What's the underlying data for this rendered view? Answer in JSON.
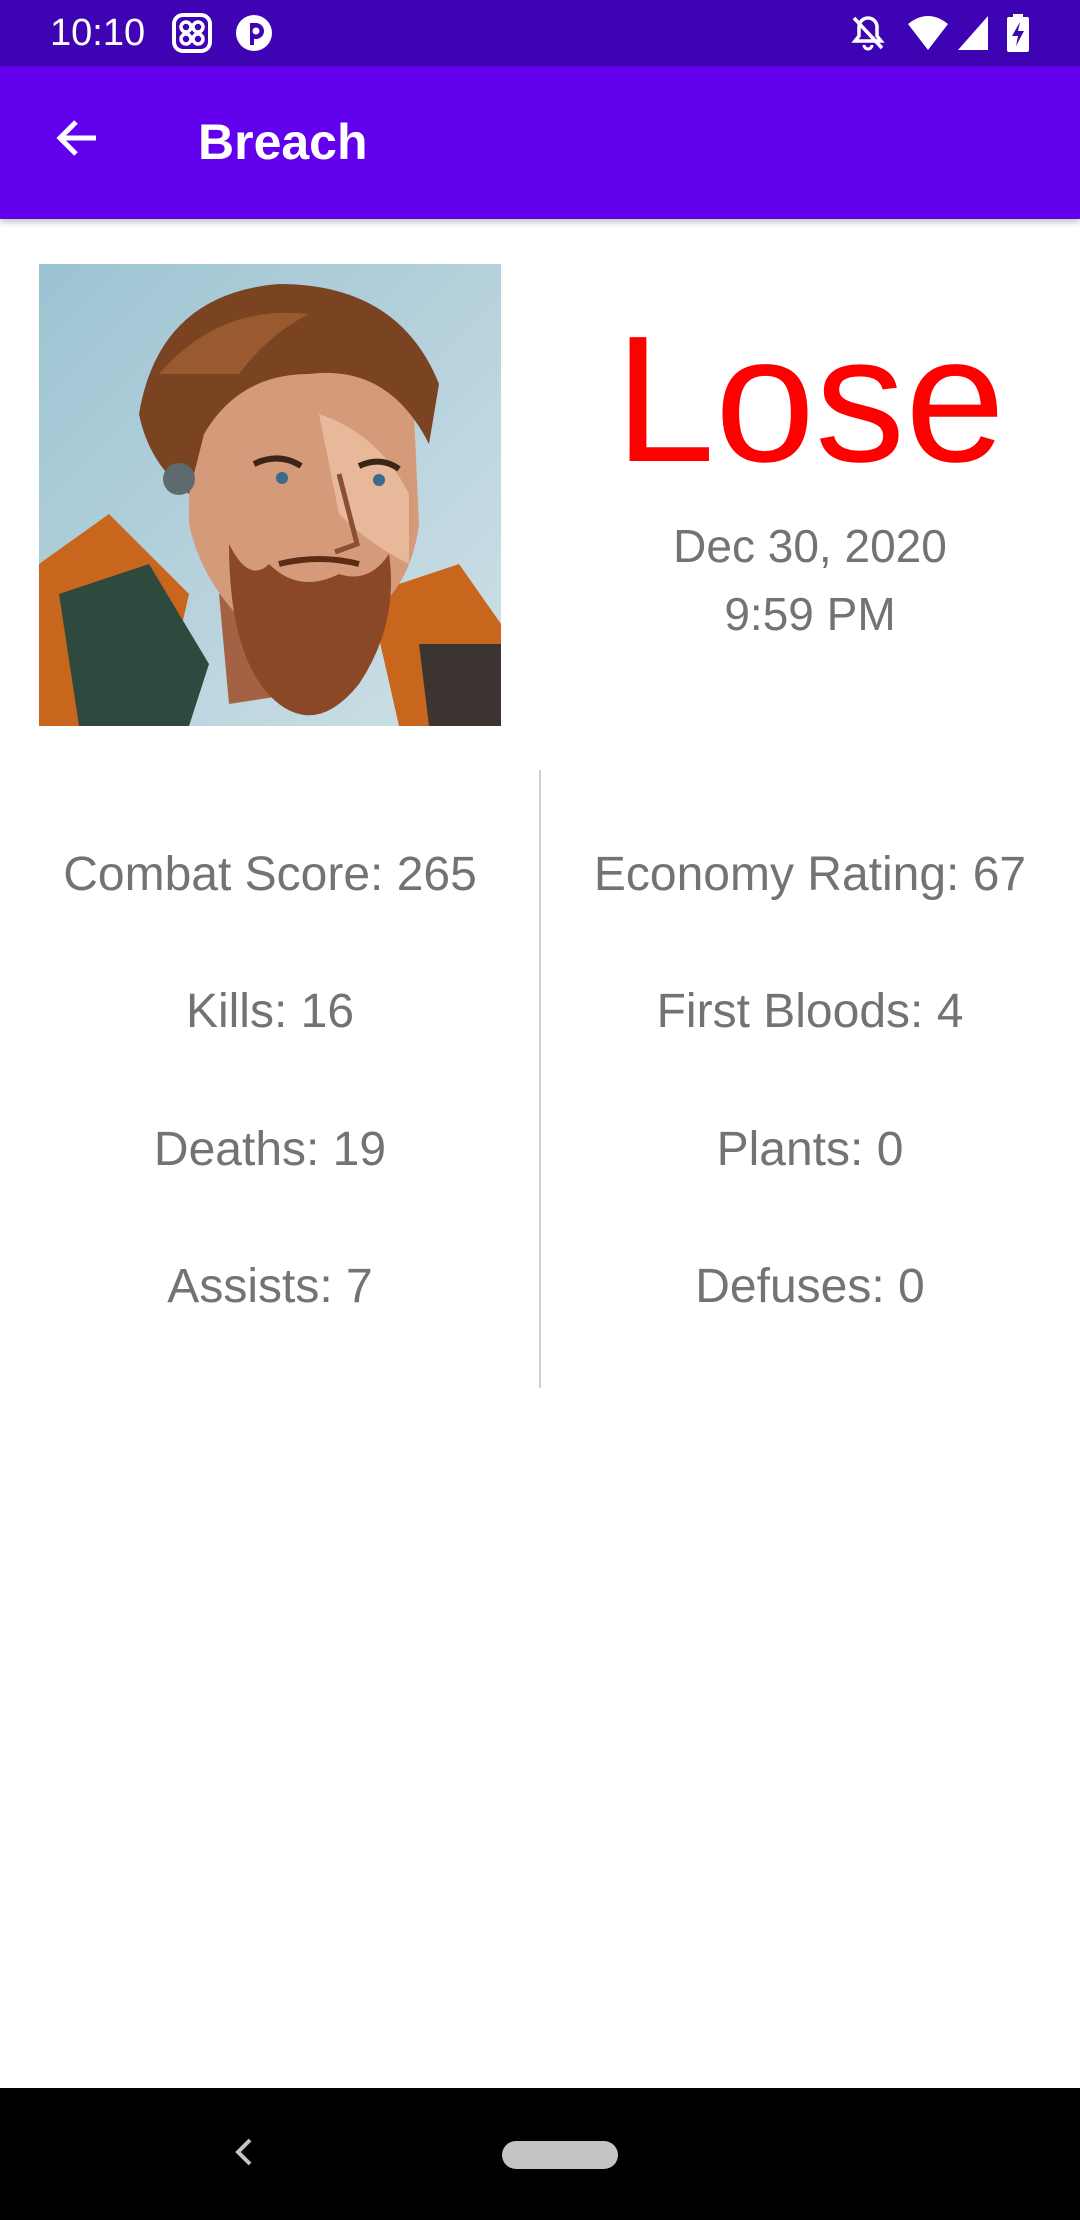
{
  "status_bar": {
    "time": "10:10",
    "left_icons": [
      "app-grid-icon",
      "pocket-casts-icon"
    ],
    "right_icons": [
      "notifications-off-icon",
      "wifi-icon",
      "cell-signal-icon",
      "battery-charging-icon"
    ]
  },
  "app_bar": {
    "title": "Breach",
    "back_icon": "arrow-back-icon",
    "background": "#6200ee"
  },
  "match": {
    "agent": "Breach",
    "result": "Lose",
    "result_color": "#ff0000",
    "date": "Dec 30, 2020",
    "time": "9:59 PM"
  },
  "stats": {
    "left": [
      "Combat Score: 265",
      "Kills: 16",
      "Deaths: 19",
      "Assists: 7"
    ],
    "right": [
      "Economy Rating: 67",
      "First Bloods: 4",
      "Plants: 0",
      "Defuses: 0"
    ]
  },
  "nav_bar": {
    "icons": [
      "nav-back-icon",
      "nav-home-pill-icon"
    ]
  }
}
